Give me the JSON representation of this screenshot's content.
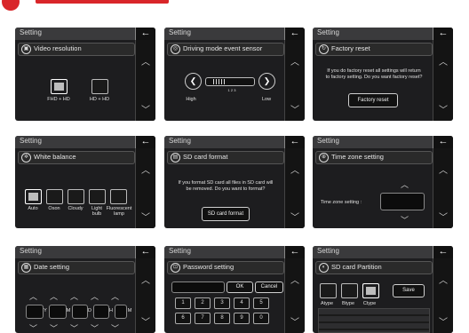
{
  "panels": [
    {
      "title": "Setting",
      "heading": "Video resolution",
      "icon": "video-icon",
      "options": [
        "FHD + HD",
        "HD + HD"
      ]
    },
    {
      "title": "Setting",
      "heading": "Driving mode event sensor",
      "low": "High",
      "high": "Low",
      "ticks": "1   2   3"
    },
    {
      "title": "Setting",
      "heading": "Factory reset",
      "message": "If you do factory reset all settings will return to factory setting. Do you want factory reset?",
      "button": "Factory reset"
    },
    {
      "title": "Setting",
      "heading": "White balance",
      "options": [
        "Auto",
        "Oson",
        "Cloudy",
        "Light bulb",
        "Fluorescent lamp"
      ]
    },
    {
      "title": "Setting",
      "heading": "SD card format",
      "message": "If you format SD card all files in SD card will be removed. Do you want to format?",
      "button": "SD card format"
    },
    {
      "title": "Setting",
      "heading": "Time zone setting",
      "label": "Time zone setting :"
    },
    {
      "title": "Setting",
      "heading": "Date setting",
      "fields": [
        "Y",
        "M",
        "D",
        "H",
        "M"
      ]
    },
    {
      "title": "Setting",
      "heading": "Password setting",
      "ok": "OK",
      "cancel": "Cancel",
      "keys": [
        "1",
        "2",
        "3",
        "4",
        "5",
        "6",
        "7",
        "8",
        "9",
        "0"
      ]
    },
    {
      "title": "Setting",
      "heading": "SD card Partition",
      "types": [
        "Atype",
        "Btype",
        "Ctype"
      ],
      "save": "Save"
    }
  ],
  "icons": {
    "back": "←",
    "up": "︿",
    "down": "﹀"
  },
  "colors": {
    "brand": "#d9262a",
    "panel": "#1d1d1f",
    "titlebar": "#3a3a3c"
  }
}
